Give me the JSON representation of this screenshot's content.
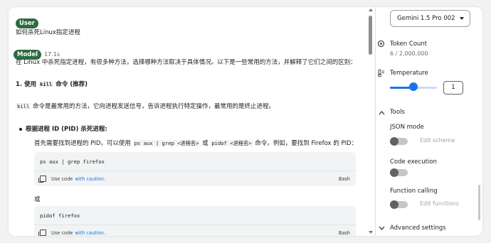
{
  "chat": {
    "user_role": "User",
    "user_message": "如何杀死Linux指定进程",
    "model_role": "Model",
    "model_time": "17.1s",
    "intro": "在 Linux 中杀死指定进程，有很多种方法，选择哪种方法取决于具体情况。以下是一些常用的方法，并解释了它们之间的区别：",
    "heading1_prefix": "1. 使用 ",
    "heading1_code": "kill",
    "heading1_suffix": " 命令 (推荐)",
    "kill_code": "kill",
    "kill_desc": " 命令是最常用的方法，它向进程发送信号，告诉进程执行特定操作，最常用的是终止进程。",
    "bullet_title": "根据进程 ID (PID) 杀死进程:",
    "step_prefix": "首先需要找到进程的 PID，可以使用 ",
    "step_code1": "ps aux | grep <进程名>",
    "step_mid": " 或 ",
    "step_code2": "pidof <进程名>",
    "step_suffix": " 命令。例如，要找到 Firefox 的 PID：",
    "code1": "ps aux | grep firefox",
    "or_text": "或",
    "code2": "pidof firefox",
    "use_code": "Use code",
    "with_caution": "with caution.",
    "lang": "Bash"
  },
  "settings": {
    "model": "Gemini 1.5 Pro 002",
    "token_count_label": "Token Count",
    "token_count_value": "6 / 2,000,000",
    "temperature_label": "Temperature",
    "temperature_value": "1",
    "temperature_fraction": 0.5,
    "tools_label": "Tools",
    "json_mode_label": "JSON mode",
    "edit_schema": "Edit schema",
    "code_execution_label": "Code execution",
    "function_calling_label": "Function calling",
    "edit_functions": "Edit functions",
    "advanced_label": "Advanced settings"
  },
  "colors": {
    "role_pill": "#2e6b3f",
    "accent": "#1a73e8",
    "code_bg": "#f1f3f4"
  }
}
